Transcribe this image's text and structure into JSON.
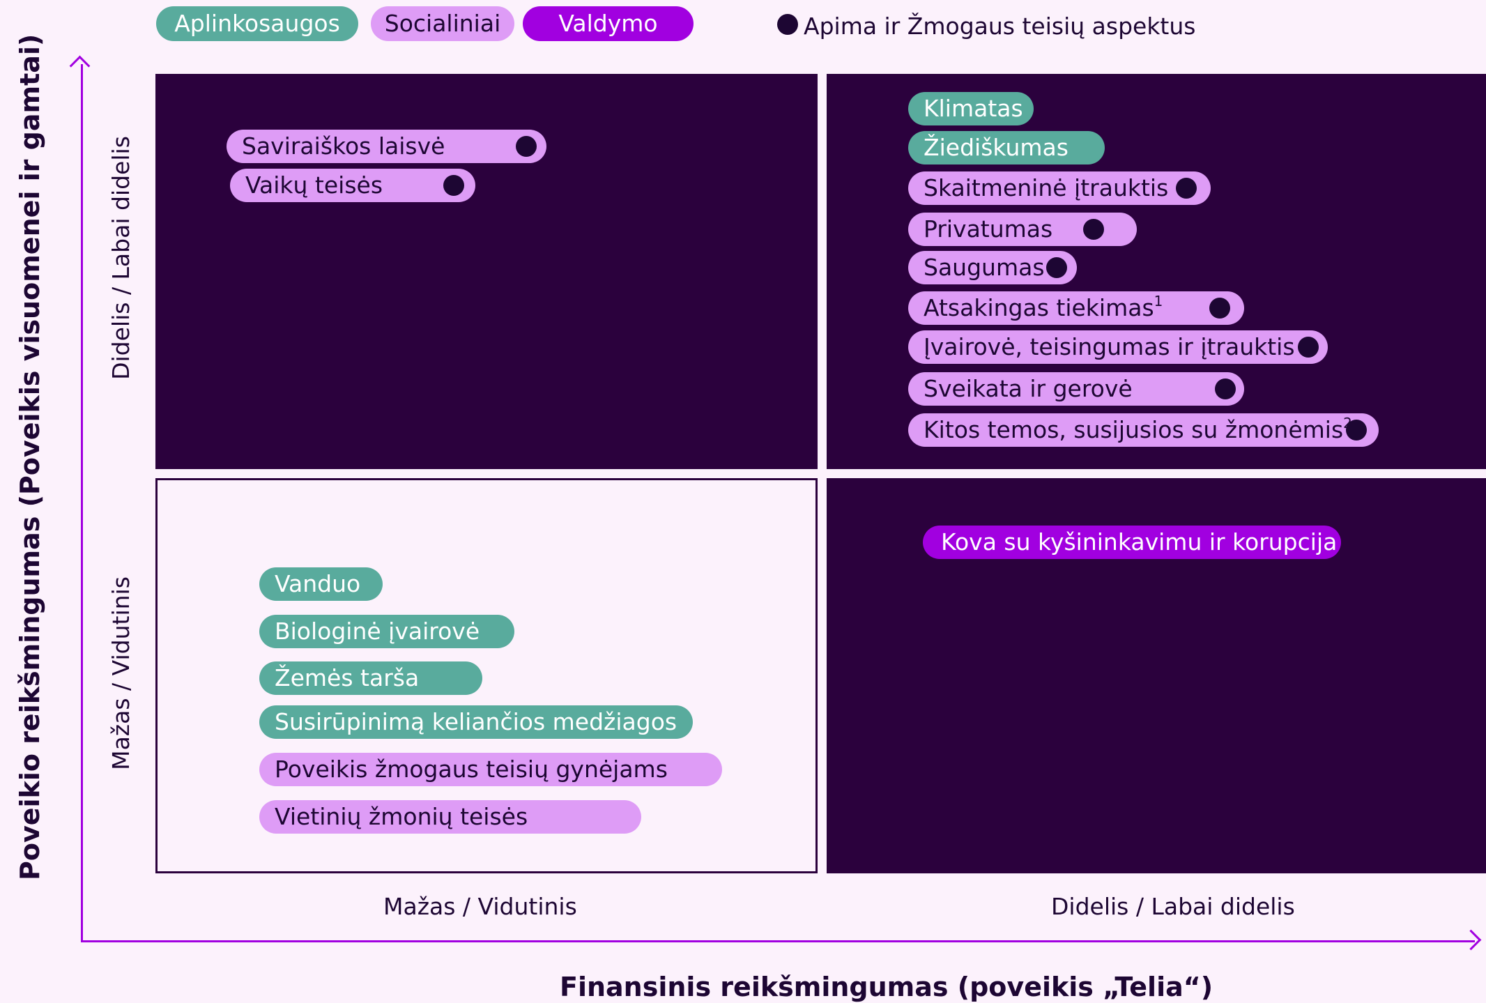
{
  "legend": {
    "environmental": "Aplinkosaugos",
    "social": "Socialiniai",
    "governance": "Valdymo",
    "human_rights_marker": "Apima ir Žmogaus teisių aspektus"
  },
  "colors": {
    "environmental": "#59ab9d",
    "social": "#de9cf6",
    "governance": "#a100e0",
    "quadrant_dark": "#2b013d",
    "axis": "#a100e0",
    "marker": "#1d0633"
  },
  "axes": {
    "y_title": "Poveikio reikšmingumas (Poveikis visuomenei ir gamtai)",
    "x_title": "Finansinis reikšmingumas (poveikis „Telia“)",
    "y_high": "Didelis / Labai didelis",
    "y_low": "Mažas / Vidutinis",
    "x_low": "Mažas / Vidutinis",
    "x_high": "Didelis / Labai didelis"
  },
  "quadrants": {
    "top_left": [
      {
        "label": "Saviraiškos laisvė",
        "category": "social",
        "human_rights": true
      },
      {
        "label": "Vaikų teisės",
        "category": "social",
        "human_rights": true
      }
    ],
    "top_right": [
      {
        "label": "Klimatas",
        "category": "environmental",
        "human_rights": false
      },
      {
        "label": "Žiediškumas",
        "category": "environmental",
        "human_rights": false
      },
      {
        "label": "Skaitmeninė įtrauktis",
        "category": "social",
        "human_rights": true
      },
      {
        "label": "Privatumas",
        "category": "social",
        "human_rights": true
      },
      {
        "label": "Saugumas",
        "category": "social",
        "human_rights": true
      },
      {
        "label": "Atsakingas tiekimas",
        "footnote": "1",
        "category": "social",
        "human_rights": true
      },
      {
        "label": "Įvairovė, teisingumas ir įtrauktis",
        "category": "social",
        "human_rights": true
      },
      {
        "label": "Sveikata ir gerovė",
        "category": "social",
        "human_rights": true
      },
      {
        "label": "Kitos temos, susijusios su žmonėmis",
        "footnote": "2",
        "category": "social",
        "human_rights": true
      }
    ],
    "bottom_left": [
      {
        "label": "Vanduo",
        "category": "environmental",
        "human_rights": false
      },
      {
        "label": "Biologinė įvairovė",
        "category": "environmental",
        "human_rights": false
      },
      {
        "label": "Žemės tarša",
        "category": "environmental",
        "human_rights": false
      },
      {
        "label": "Susirūpinimą keliančios medžiagos",
        "category": "environmental",
        "human_rights": false
      },
      {
        "label": "Poveikis žmogaus teisių gynėjams",
        "category": "social",
        "human_rights": false
      },
      {
        "label": "Vietinių žmonių teisės",
        "category": "social",
        "human_rights": false
      }
    ],
    "bottom_right": [
      {
        "label": "Kova su kyšininkavimu ir korupcija",
        "category": "governance",
        "human_rights": false
      }
    ]
  }
}
